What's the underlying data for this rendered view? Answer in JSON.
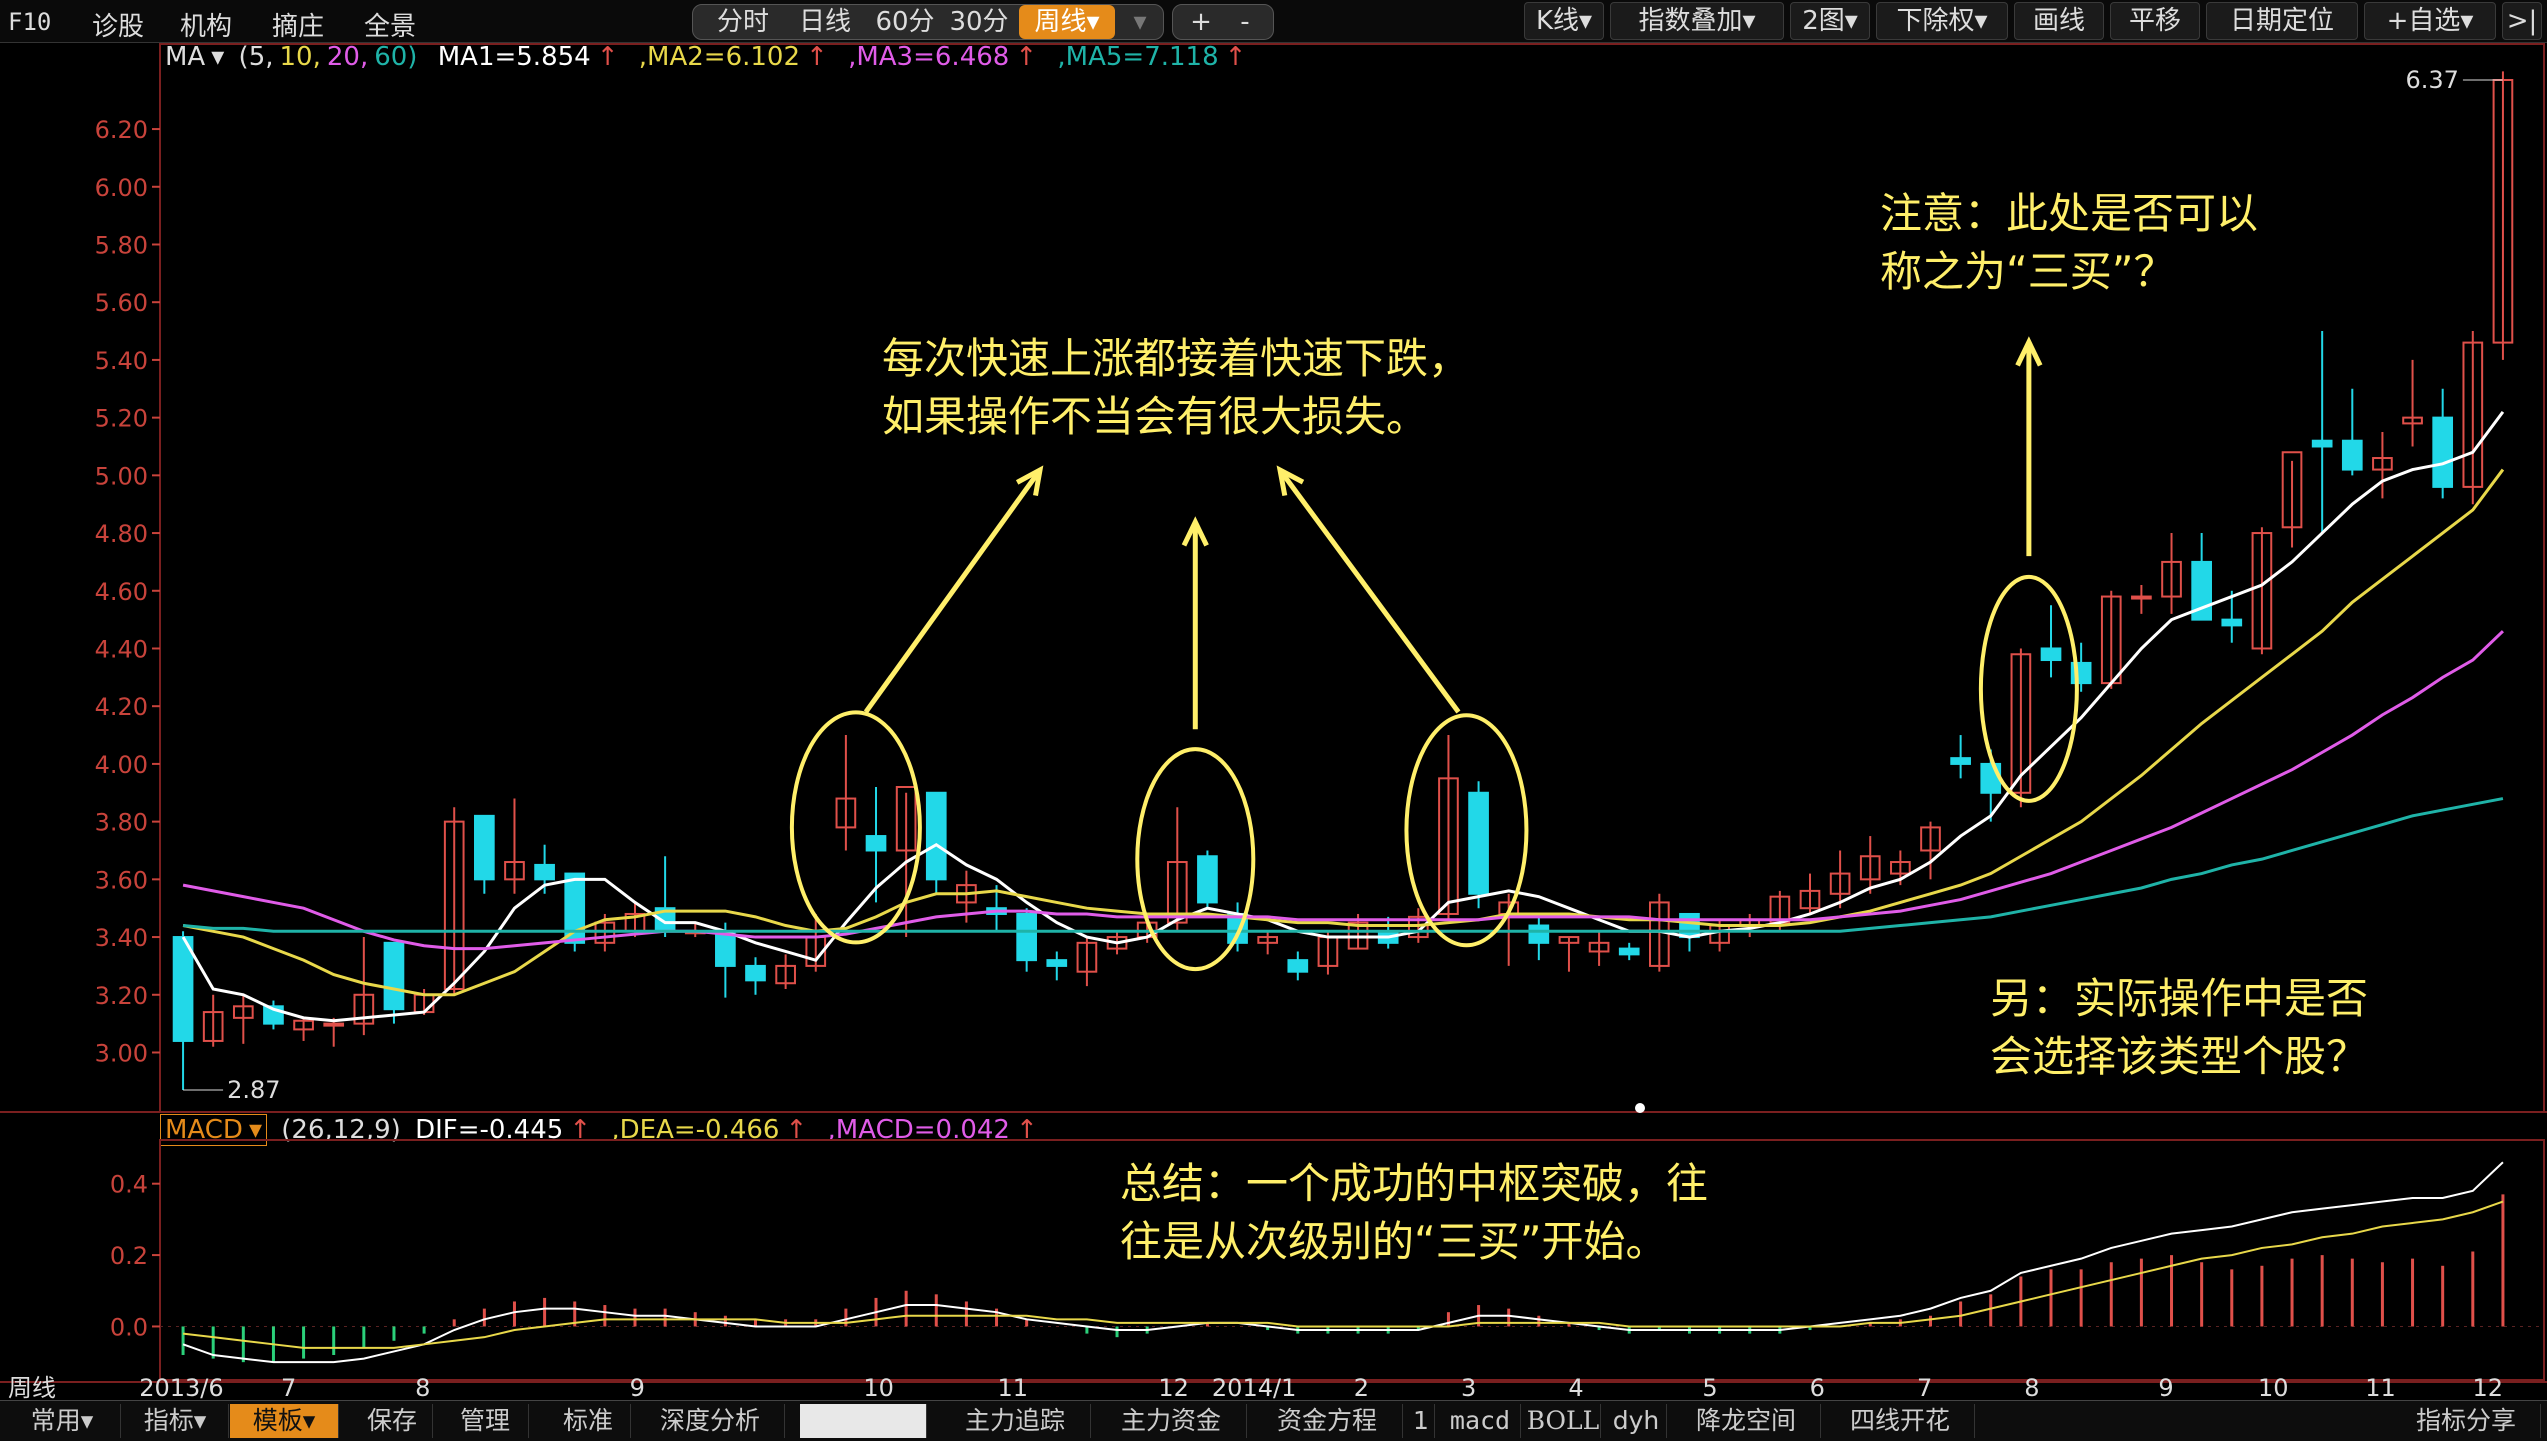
{
  "menu": {
    "f10": "F10",
    "diagnose": "诊股",
    "institution": "机构",
    "dealer": "摘庄",
    "panorama": "全景"
  },
  "periods": [
    "分时",
    "日线",
    "60分",
    "30分",
    "周线"
  ],
  "active_period": "周线",
  "zoom_controls": [
    "+",
    "-"
  ],
  "tools": [
    "K线",
    "指数叠加",
    "2图",
    "下除权",
    "画线",
    "平移",
    "日期定位",
    "+自选",
    ">|"
  ],
  "ma_legend": {
    "label": "MA",
    "params_prefix": "(5,",
    "p2": "10,",
    "p3": "20,",
    "p4": "60)",
    "ma1": "MA1=5.854",
    "ma2": ",MA2=6.102",
    "ma3": ",MA3=6.468",
    "ma5": ",MA5=7.118",
    "up_arrow": "↑"
  },
  "macd_legend": {
    "label": "MACD",
    "params": "(26,12,9)",
    "dif": "DIF=-0.445",
    "dea": ",DEA=-0.466",
    "macd": ",MACD=0.042",
    "up_arrow": "↑"
  },
  "annotations": {
    "top_center_line1": "每次快速上涨都接着快速下跌，",
    "top_center_line2": "如果操作不当会有很大损失。",
    "top_right_line1": "注意：此处是否可以",
    "top_right_line2": "称之为“三买”？",
    "bottom_right_line1": "另：实际操作中是否",
    "bottom_right_line2": "会选择该类型个股？",
    "summary_line1": "总结：一个成功的中枢突破，往",
    "summary_line2": "往是从次级别的“三买”开始。"
  },
  "x_axis_labels": [
    "周线",
    "2013/6",
    "7",
    "8",
    "9",
    "10",
    "11",
    "12",
    "2014/1",
    "2",
    "3",
    "4",
    "5",
    "6",
    "7",
    "8",
    "9",
    "10",
    "11",
    "12"
  ],
  "bottom_tabs": [
    "常用",
    "指标",
    "模板",
    "保存",
    "管理",
    "标准",
    "深度分析",
    "",
    "主力追踪",
    "主力资金",
    "资金方程",
    "1",
    "macd",
    "BOLL",
    "dyh",
    "降龙空间",
    "四线开花",
    "指标分享"
  ],
  "active_bottom_tab": "模板",
  "colors": {
    "up": "#e0504a",
    "down": "#22d8e8",
    "ma1": "#ffffff",
    "ma2": "#e8d84a",
    "ma3": "#e05ce8",
    "ma5": "#1fb3a8",
    "axis": "#c8433b",
    "annotation": "#ffef6a",
    "accent": "#e58b1a"
  },
  "chart_data": [
    {
      "type": "candlestick",
      "title": "",
      "ylim": [
        2.87,
        6.37
      ],
      "y_ticks": [
        "6.20",
        "6.00",
        "5.80",
        "5.60",
        "5.40",
        "5.20",
        "5.00",
        "4.80",
        "4.60",
        "4.40",
        "4.20",
        "4.00",
        "3.80",
        "3.60",
        "3.40",
        "3.20",
        "3.00"
      ],
      "high_label": "6.37",
      "low_label": "2.87",
      "ohlc": [
        [
          3.4,
          3.42,
          2.87,
          3.04
        ],
        [
          3.04,
          3.2,
          3.02,
          3.14
        ],
        [
          3.12,
          3.2,
          3.03,
          3.16
        ],
        [
          3.16,
          3.18,
          3.08,
          3.1
        ],
        [
          3.08,
          3.12,
          3.04,
          3.11
        ],
        [
          3.1,
          3.12,
          3.02,
          3.1
        ],
        [
          3.1,
          3.4,
          3.06,
          3.2
        ],
        [
          3.38,
          3.38,
          3.1,
          3.15
        ],
        [
          3.14,
          3.22,
          3.13,
          3.2
        ],
        [
          3.22,
          3.85,
          3.2,
          3.8
        ],
        [
          3.82,
          3.82,
          3.55,
          3.6
        ],
        [
          3.6,
          3.88,
          3.55,
          3.66
        ],
        [
          3.65,
          3.72,
          3.55,
          3.6
        ],
        [
          3.62,
          3.62,
          3.35,
          3.38
        ],
        [
          3.38,
          3.48,
          3.35,
          3.45
        ],
        [
          3.42,
          3.52,
          3.4,
          3.48
        ],
        [
          3.5,
          3.68,
          3.4,
          3.42
        ],
        [
          3.42,
          3.45,
          3.4,
          3.42
        ],
        [
          3.42,
          3.45,
          3.19,
          3.3
        ],
        [
          3.3,
          3.33,
          3.2,
          3.25
        ],
        [
          3.24,
          3.34,
          3.22,
          3.3
        ],
        [
          3.3,
          3.48,
          3.28,
          3.4
        ],
        [
          3.78,
          4.1,
          3.7,
          3.88
        ],
        [
          3.75,
          3.92,
          3.52,
          3.7
        ],
        [
          3.7,
          3.9,
          3.4,
          3.92
        ],
        [
          3.9,
          3.9,
          3.55,
          3.6
        ],
        [
          3.52,
          3.63,
          3.45,
          3.58
        ],
        [
          3.5,
          3.58,
          3.42,
          3.48
        ],
        [
          3.48,
          3.5,
          3.28,
          3.32
        ],
        [
          3.32,
          3.35,
          3.25,
          3.3
        ],
        [
          3.28,
          3.4,
          3.23,
          3.38
        ],
        [
          3.36,
          3.42,
          3.34,
          3.4
        ],
        [
          3.4,
          3.47,
          3.38,
          3.45
        ],
        [
          3.45,
          3.85,
          3.42,
          3.66
        ],
        [
          3.68,
          3.7,
          3.5,
          3.52
        ],
        [
          3.48,
          3.52,
          3.35,
          3.38
        ],
        [
          3.38,
          3.42,
          3.34,
          3.4
        ],
        [
          3.32,
          3.35,
          3.25,
          3.28
        ],
        [
          3.3,
          3.42,
          3.27,
          3.4
        ],
        [
          3.36,
          3.48,
          3.36,
          3.45
        ],
        [
          3.42,
          3.47,
          3.36,
          3.38
        ],
        [
          3.4,
          3.5,
          3.38,
          3.47
        ],
        [
          3.48,
          4.1,
          3.46,
          3.95
        ],
        [
          3.9,
          3.94,
          3.5,
          3.55
        ],
        [
          3.48,
          3.55,
          3.3,
          3.52
        ],
        [
          3.44,
          3.48,
          3.32,
          3.38
        ],
        [
          3.38,
          3.4,
          3.28,
          3.4
        ],
        [
          3.35,
          3.42,
          3.3,
          3.38
        ],
        [
          3.36,
          3.38,
          3.32,
          3.34
        ],
        [
          3.3,
          3.55,
          3.28,
          3.52
        ],
        [
          3.48,
          3.48,
          3.35,
          3.4
        ],
        [
          3.38,
          3.46,
          3.35,
          3.44
        ],
        [
          3.44,
          3.48,
          3.4,
          3.46
        ],
        [
          3.45,
          3.56,
          3.42,
          3.54
        ],
        [
          3.5,
          3.62,
          3.48,
          3.56
        ],
        [
          3.55,
          3.7,
          3.5,
          3.62
        ],
        [
          3.6,
          3.75,
          3.55,
          3.68
        ],
        [
          3.62,
          3.7,
          3.58,
          3.66
        ],
        [
          3.7,
          3.8,
          3.6,
          3.78
        ],
        [
          4.02,
          4.1,
          3.95,
          4.0
        ],
        [
          4.0,
          4.05,
          3.8,
          3.9
        ],
        [
          3.9,
          4.4,
          3.85,
          4.38
        ],
        [
          4.4,
          4.55,
          4.3,
          4.36
        ],
        [
          4.35,
          4.42,
          4.25,
          4.28
        ],
        [
          4.28,
          4.6,
          4.26,
          4.58
        ],
        [
          4.58,
          4.62,
          4.52,
          4.58
        ],
        [
          4.58,
          4.8,
          4.52,
          4.7
        ],
        [
          4.7,
          4.8,
          4.5,
          4.5
        ],
        [
          4.5,
          4.6,
          4.42,
          4.48
        ],
        [
          4.4,
          4.82,
          4.38,
          4.8
        ],
        [
          4.82,
          5.05,
          4.75,
          5.08
        ],
        [
          5.12,
          5.5,
          4.8,
          5.1
        ],
        [
          5.12,
          5.3,
          5.0,
          5.02
        ],
        [
          5.02,
          5.15,
          4.92,
          5.06
        ],
        [
          5.18,
          5.4,
          5.1,
          5.2
        ],
        [
          5.2,
          5.3,
          4.92,
          4.96
        ],
        [
          4.96,
          5.5,
          4.9,
          5.46
        ],
        [
          5.46,
          6.4,
          5.4,
          6.37
        ]
      ],
      "series": [
        {
          "name": "MA1",
          "values": [
            3.4,
            3.22,
            3.2,
            3.15,
            3.12,
            3.11,
            3.12,
            3.13,
            3.14,
            3.24,
            3.35,
            3.5,
            3.58,
            3.6,
            3.6,
            3.52,
            3.45,
            3.45,
            3.42,
            3.38,
            3.35,
            3.32,
            3.45,
            3.57,
            3.66,
            3.72,
            3.65,
            3.6,
            3.52,
            3.45,
            3.4,
            3.38,
            3.4,
            3.46,
            3.5,
            3.48,
            3.46,
            3.42,
            3.4,
            3.4,
            3.4,
            3.42,
            3.52,
            3.54,
            3.56,
            3.54,
            3.5,
            3.46,
            3.42,
            3.42,
            3.4,
            3.42,
            3.43,
            3.45,
            3.48,
            3.52,
            3.57,
            3.6,
            3.66,
            3.75,
            3.82,
            3.96,
            4.06,
            4.16,
            4.28,
            4.4,
            4.5,
            4.54,
            4.58,
            4.62,
            4.7,
            4.8,
            4.9,
            4.98,
            5.02,
            5.04,
            5.08,
            5.22
          ]
        },
        {
          "name": "MA2",
          "values": [
            3.44,
            3.42,
            3.4,
            3.36,
            3.32,
            3.27,
            3.24,
            3.22,
            3.2,
            3.2,
            3.24,
            3.28,
            3.35,
            3.42,
            3.46,
            3.47,
            3.49,
            3.49,
            3.49,
            3.47,
            3.44,
            3.42,
            3.43,
            3.47,
            3.52,
            3.55,
            3.55,
            3.56,
            3.54,
            3.52,
            3.5,
            3.49,
            3.48,
            3.48,
            3.48,
            3.47,
            3.46,
            3.45,
            3.45,
            3.44,
            3.44,
            3.44,
            3.45,
            3.46,
            3.48,
            3.48,
            3.48,
            3.47,
            3.46,
            3.46,
            3.45,
            3.44,
            3.44,
            3.44,
            3.45,
            3.47,
            3.49,
            3.52,
            3.55,
            3.58,
            3.62,
            3.68,
            3.74,
            3.8,
            3.88,
            3.96,
            4.05,
            4.14,
            4.22,
            4.3,
            4.38,
            4.46,
            4.56,
            4.64,
            4.72,
            4.8,
            4.88,
            5.02
          ]
        },
        {
          "name": "MA3",
          "values": [
            3.58,
            3.56,
            3.54,
            3.52,
            3.5,
            3.46,
            3.42,
            3.39,
            3.37,
            3.36,
            3.36,
            3.37,
            3.38,
            3.39,
            3.4,
            3.41,
            3.42,
            3.42,
            3.41,
            3.4,
            3.4,
            3.4,
            3.41,
            3.43,
            3.45,
            3.47,
            3.48,
            3.49,
            3.49,
            3.48,
            3.48,
            3.47,
            3.47,
            3.47,
            3.47,
            3.47,
            3.47,
            3.46,
            3.46,
            3.46,
            3.46,
            3.46,
            3.46,
            3.46,
            3.47,
            3.47,
            3.47,
            3.47,
            3.47,
            3.46,
            3.46,
            3.46,
            3.46,
            3.46,
            3.46,
            3.47,
            3.48,
            3.49,
            3.51,
            3.53,
            3.56,
            3.59,
            3.62,
            3.66,
            3.7,
            3.74,
            3.78,
            3.83,
            3.88,
            3.93,
            3.98,
            4.04,
            4.1,
            4.17,
            4.23,
            4.3,
            4.36,
            4.46
          ]
        },
        {
          "name": "MA5",
          "values": [
            3.44,
            3.43,
            3.43,
            3.42,
            3.42,
            3.42,
            3.42,
            3.42,
            3.42,
            3.42,
            3.42,
            3.42,
            3.42,
            3.42,
            3.42,
            3.42,
            3.42,
            3.42,
            3.42,
            3.42,
            3.42,
            3.42,
            3.42,
            3.42,
            3.42,
            3.42,
            3.42,
            3.42,
            3.42,
            3.42,
            3.42,
            3.42,
            3.42,
            3.42,
            3.42,
            3.42,
            3.42,
            3.42,
            3.42,
            3.42,
            3.42,
            3.42,
            3.42,
            3.42,
            3.42,
            3.42,
            3.42,
            3.42,
            3.42,
            3.42,
            3.42,
            3.42,
            3.42,
            3.42,
            3.42,
            3.42,
            3.43,
            3.44,
            3.45,
            3.46,
            3.47,
            3.49,
            3.51,
            3.53,
            3.55,
            3.57,
            3.6,
            3.62,
            3.65,
            3.67,
            3.7,
            3.73,
            3.76,
            3.79,
            3.82,
            3.84,
            3.86,
            3.88
          ]
        }
      ]
    },
    {
      "type": "bar",
      "title": "",
      "ylim": [
        -0.15,
        0.5
      ],
      "y_ticks": [
        "0.4",
        "0.2",
        "0.0"
      ],
      "values": [
        -0.08,
        -0.09,
        -0.1,
        -0.1,
        -0.09,
        -0.08,
        -0.06,
        -0.04,
        -0.02,
        0.02,
        0.05,
        0.07,
        0.08,
        0.07,
        0.06,
        0.05,
        0.05,
        0.04,
        0.03,
        0.02,
        0.02,
        0.02,
        0.05,
        0.08,
        0.1,
        0.09,
        0.07,
        0.05,
        0.02,
        0.0,
        -0.02,
        -0.03,
        -0.02,
        0.0,
        0.01,
        0.0,
        -0.01,
        -0.02,
        -0.02,
        -0.02,
        -0.02,
        -0.01,
        0.04,
        0.06,
        0.05,
        0.03,
        0.01,
        -0.01,
        -0.02,
        -0.01,
        -0.02,
        -0.02,
        -0.02,
        -0.02,
        -0.01,
        0.0,
        0.01,
        0.02,
        0.03,
        0.07,
        0.09,
        0.14,
        0.16,
        0.16,
        0.18,
        0.19,
        0.2,
        0.18,
        0.16,
        0.17,
        0.19,
        0.2,
        0.19,
        0.18,
        0.19,
        0.17,
        0.21,
        0.37
      ],
      "series": [
        {
          "name": "DIF",
          "values": [
            -0.05,
            -0.08,
            -0.09,
            -0.1,
            -0.1,
            -0.1,
            -0.09,
            -0.07,
            -0.05,
            -0.01,
            0.02,
            0.04,
            0.05,
            0.05,
            0.04,
            0.03,
            0.03,
            0.02,
            0.01,
            0.0,
            0.0,
            0.0,
            0.02,
            0.04,
            0.06,
            0.06,
            0.05,
            0.04,
            0.02,
            0.01,
            0.0,
            -0.01,
            -0.01,
            0.0,
            0.01,
            0.01,
            0.0,
            -0.01,
            -0.01,
            -0.01,
            -0.01,
            -0.01,
            0.01,
            0.03,
            0.03,
            0.02,
            0.01,
            0.0,
            -0.01,
            -0.01,
            -0.01,
            -0.01,
            -0.01,
            -0.01,
            0.0,
            0.01,
            0.02,
            0.03,
            0.05,
            0.08,
            0.1,
            0.15,
            0.17,
            0.19,
            0.22,
            0.24,
            0.26,
            0.27,
            0.28,
            0.3,
            0.32,
            0.33,
            0.34,
            0.35,
            0.36,
            0.36,
            0.38,
            0.46
          ]
        },
        {
          "name": "DEA",
          "values": [
            -0.02,
            -0.03,
            -0.04,
            -0.05,
            -0.06,
            -0.06,
            -0.06,
            -0.06,
            -0.05,
            -0.04,
            -0.03,
            -0.01,
            0.0,
            0.01,
            0.02,
            0.02,
            0.02,
            0.02,
            0.02,
            0.02,
            0.01,
            0.01,
            0.01,
            0.02,
            0.03,
            0.03,
            0.03,
            0.03,
            0.03,
            0.02,
            0.02,
            0.01,
            0.01,
            0.01,
            0.01,
            0.01,
            0.01,
            0.0,
            0.0,
            0.0,
            0.0,
            0.0,
            0.0,
            0.01,
            0.01,
            0.01,
            0.01,
            0.01,
            0.0,
            0.0,
            0.0,
            0.0,
            0.0,
            0.0,
            0.0,
            0.0,
            0.01,
            0.01,
            0.02,
            0.03,
            0.05,
            0.07,
            0.09,
            0.11,
            0.13,
            0.15,
            0.17,
            0.19,
            0.2,
            0.22,
            0.23,
            0.25,
            0.26,
            0.28,
            0.29,
            0.3,
            0.32,
            0.35
          ]
        }
      ]
    }
  ]
}
